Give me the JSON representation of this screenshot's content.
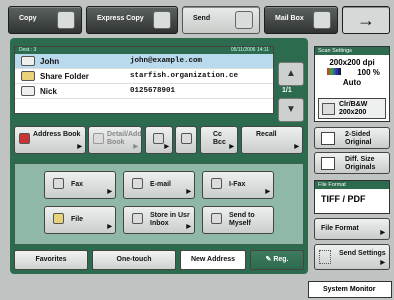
{
  "top_tabs": [
    {
      "label": "Copy"
    },
    {
      "label": "Express Copy"
    },
    {
      "label": "Send"
    },
    {
      "label": "Mail Box"
    },
    {
      "label": "→"
    }
  ],
  "dest_bar": {
    "left": "Dest.:   3",
    "right": "05/11/2006  14:11"
  },
  "destinations": [
    {
      "name": "John",
      "value": "john@example.com",
      "icon": "email-icon"
    },
    {
      "name": "Share Folder",
      "value": "starfish.organization.ce",
      "icon": "folder-icon"
    },
    {
      "name": "Nick",
      "value": "0125678901",
      "icon": "fax-icon"
    }
  ],
  "pagination": {
    "page": "1/1"
  },
  "action_buttons": {
    "address_book": "Address Book",
    "detail_add": "Detail/Add Book",
    "cc_bcc": "Cc Bcc",
    "recall": "Recall"
  },
  "functions": {
    "fax": "Fax",
    "email": "E-mail",
    "ifax": "I-Fax",
    "file": "File",
    "store_inbox": "Store in Usr Inbox",
    "send_myself": "Send to Myself"
  },
  "bottom_tabs": {
    "favorites": "Favorites",
    "one_touch": "One-touch",
    "new_address": "New Address",
    "reg": "Reg."
  },
  "scan_settings": {
    "header": "Scan Settings",
    "resolution": "200x200 dpi",
    "scale": "100 %",
    "mode": "Auto",
    "color": "Clr/B&W",
    "size": "200x200"
  },
  "side_buttons": {
    "two_sided": "2-Sided Original",
    "diff_size": "Diff. Size Originals",
    "file_format_header": "File Format",
    "file_format_value": "TIFF / PDF",
    "file_format_btn": "File Format",
    "send_settings": "Send Settings"
  },
  "system_monitor": "System Monitor"
}
